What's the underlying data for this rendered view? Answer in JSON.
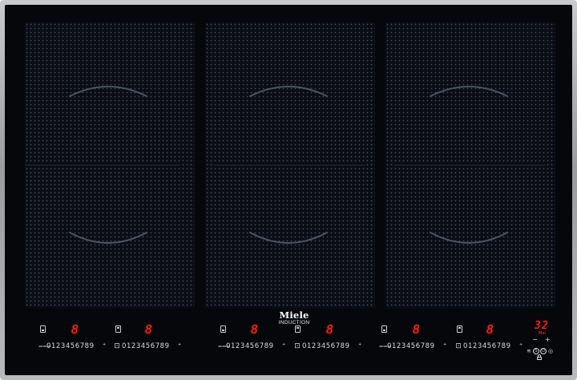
{
  "brand": {
    "name": "Miele",
    "tagline": "INDUCTION"
  },
  "colors": {
    "glass": "#05070b",
    "display_red": "#ff2b1a",
    "frame": "#b0b1b4"
  },
  "cooking_zones": [
    {
      "id": "left",
      "front_display": "8",
      "rear_display": "8"
    },
    {
      "id": "center",
      "front_display": "8",
      "rear_display": "8"
    },
    {
      "id": "right",
      "front_display": "8",
      "rear_display": "8"
    }
  ],
  "power_scale": {
    "levels": "0123456789",
    "boost_mark": "+",
    "icon": "cookware-icon"
  },
  "timer": {
    "display": "32",
    "unit": "Min",
    "minus": "−",
    "plus": "+"
  },
  "system_controls": {
    "on_off_label": "⏻",
    "stopngo_label": "S",
    "icons": [
      "power-icon",
      "keep-warm-icon",
      "stop-go-icon",
      "wipe-icon",
      "lock-icon"
    ]
  }
}
